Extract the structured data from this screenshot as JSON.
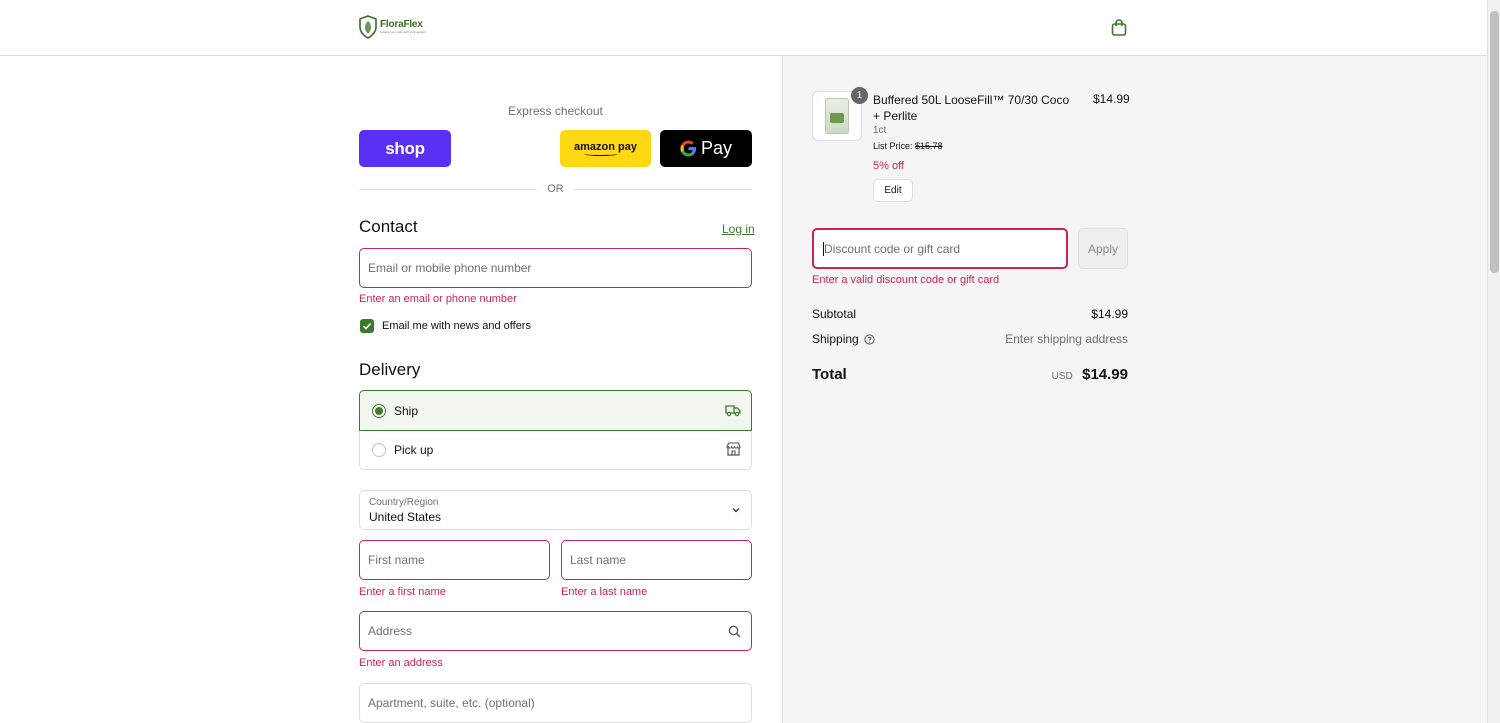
{
  "brand": {
    "name": "FloraFlex",
    "tagline": "helping you grow with your garden"
  },
  "express": {
    "label": "Express checkout",
    "shop_label": "shop",
    "amazon_label": "amazon pay",
    "gpay_label": "Pay",
    "or_label": "OR"
  },
  "contact": {
    "title": "Contact",
    "login_label": "Log in",
    "email_placeholder": "Email or mobile phone number",
    "email_error": "Enter an email or phone number",
    "newsletter_label": "Email me with news and offers",
    "newsletter_checked": true
  },
  "delivery": {
    "title": "Delivery",
    "options": [
      {
        "label": "Ship",
        "selected": true,
        "icon": "truck-icon"
      },
      {
        "label": "Pick up",
        "selected": false,
        "icon": "store-icon"
      }
    ],
    "country_label": "Country/Region",
    "country_value": "United States",
    "first_name_placeholder": "First name",
    "first_name_error": "Enter a first name",
    "last_name_placeholder": "Last name",
    "last_name_error": "Enter a last name",
    "address_placeholder": "Address",
    "address_error": "Enter an address",
    "apartment_placeholder": "Apartment, suite, etc. (optional)"
  },
  "order": {
    "product": {
      "quantity": "1",
      "name": "Buffered 50L LooseFill™ 70/30 Coco + Perlite",
      "price": "$14.99",
      "variant": "1ct",
      "list_price_label": "List Price:",
      "list_price": "$15.78",
      "discount": "5% off",
      "edit_label": "Edit"
    },
    "discount_placeholder": "Discount code or gift card",
    "discount_error": "Enter a valid discount code or gift card",
    "apply_label": "Apply",
    "subtotal_label": "Subtotal",
    "subtotal_value": "$14.99",
    "shipping_label": "Shipping",
    "shipping_value": "Enter shipping address",
    "total_label": "Total",
    "total_currency": "USD",
    "total_value": "$14.99"
  },
  "colors": {
    "accent": "#3b7a2b",
    "error": "#c8245a",
    "shop_purple": "#5a31f4",
    "amazon_yellow": "#ffd814"
  }
}
